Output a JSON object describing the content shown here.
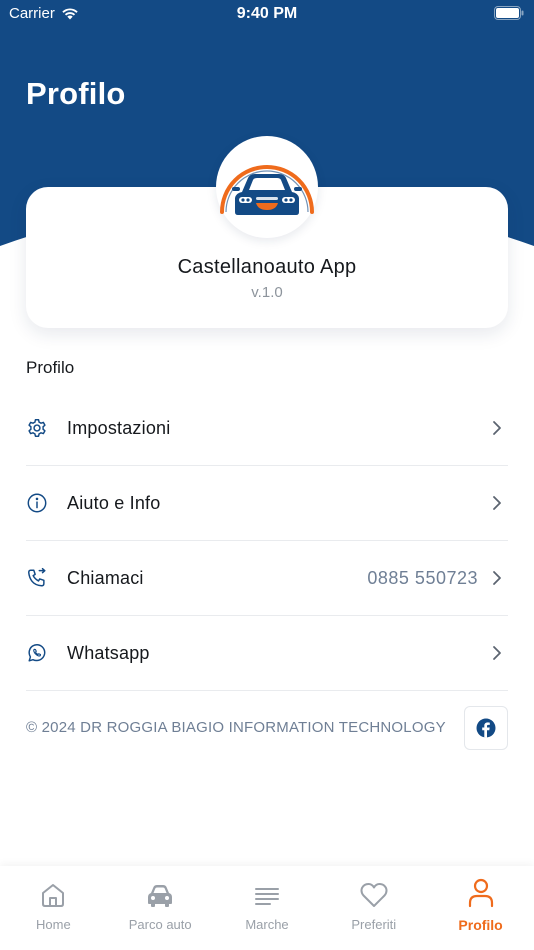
{
  "status_bar": {
    "carrier": "Carrier",
    "time": "9:40 PM"
  },
  "header": {
    "title": "Profilo",
    "background_color": "#134a85"
  },
  "app_card": {
    "logo_icon": "car-logo-icon",
    "name": "Castellanoauto App",
    "version": "v.1.0"
  },
  "section": {
    "title": "Profilo"
  },
  "menu": {
    "items": [
      {
        "label": "Impostazioni",
        "icon": "gear-icon",
        "value": ""
      },
      {
        "label": "Aiuto e Info",
        "icon": "info-icon",
        "value": ""
      },
      {
        "label": "Chiamaci",
        "icon": "phone-icon",
        "value": "0885 550723"
      },
      {
        "label": "Whatsapp",
        "icon": "whatsapp-icon",
        "value": ""
      }
    ]
  },
  "footer": {
    "copyright": "© 2024 DR ROGGIA BIAGIO INFORMATION TECHNOLOGY",
    "social_icon": "facebook-icon"
  },
  "tab_bar": {
    "tabs": [
      {
        "label": "Home",
        "icon": "home-icon"
      },
      {
        "label": "Parco auto",
        "icon": "car-icon"
      },
      {
        "label": "Marche",
        "icon": "list-icon"
      },
      {
        "label": "Preferiti",
        "icon": "heart-icon"
      },
      {
        "label": "Profilo",
        "icon": "user-icon"
      }
    ],
    "active": "Profilo"
  },
  "colors": {
    "brand_blue": "#134a85",
    "accent_orange": "#ef6b1c",
    "muted_text": "#6f7f95",
    "inactive_tab": "#9aa0a8"
  }
}
